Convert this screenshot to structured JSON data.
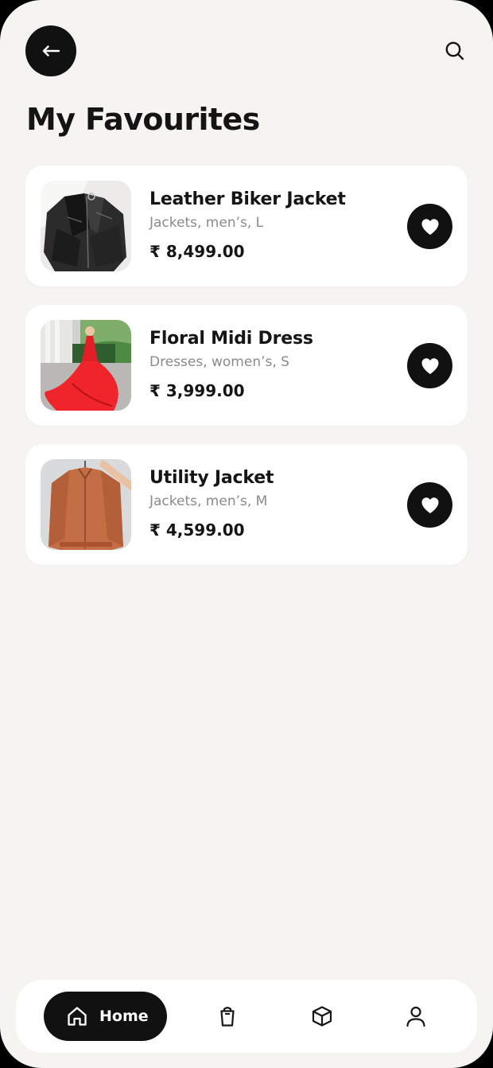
{
  "header": {
    "title": "My Favourites",
    "back_icon": "arrow-left-icon",
    "search_icon": "search-icon"
  },
  "favourites": [
    {
      "name": "Leather Biker Jacket",
      "meta": "Jackets, men’s, L",
      "price": "₹ 8,499.00",
      "image": "black leather biker jacket",
      "favourite_icon": "heart-icon"
    },
    {
      "name": "Floral Midi Dress",
      "meta": "Dresses, women’s, S",
      "price": "₹ 3,999.00",
      "image": "red flowing midi dress",
      "favourite_icon": "heart-icon"
    },
    {
      "name": "Utility Jacket",
      "meta": "Jackets, men’s, M",
      "price": "₹ 4,599.00",
      "image": "rust orange bomber jacket",
      "favourite_icon": "heart-icon"
    }
  ],
  "bottom_nav": {
    "items": [
      {
        "label": "Home",
        "icon": "home-icon",
        "active": true
      },
      {
        "label": "",
        "icon": "shopping-bag-icon",
        "active": false
      },
      {
        "label": "",
        "icon": "box-icon",
        "active": false
      },
      {
        "label": "",
        "icon": "user-icon",
        "active": false
      }
    ]
  },
  "colors": {
    "background": "#f5f4f1",
    "card": "#ffffff",
    "accent": "#111111",
    "muted_text": "#8a8a8a"
  }
}
